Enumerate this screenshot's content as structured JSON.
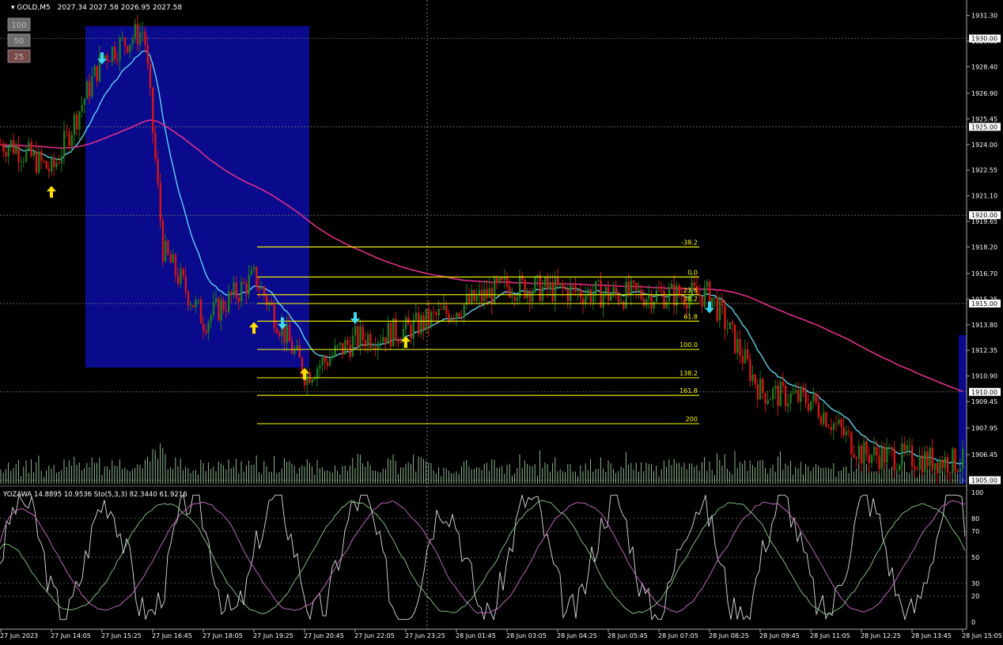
{
  "header": {
    "symbol": "GOLD,M5",
    "ohlc": "2027.34 2027.58 2026.95 2027.58"
  },
  "zoom_buttons": [
    "100",
    "50",
    "25"
  ],
  "indicator_header": "YOZAWA 14.8895 10.9536  Sto(5,3,3) 82.3440 61.9216",
  "colors": {
    "background": "#000000",
    "bull_bar": "#1e7a1e",
    "bear_bar": "#d41616",
    "ma_fast": "#5fd3f0",
    "ma_slow": "#e0308a",
    "fib": "#ffff00",
    "box": "#0a0a8c",
    "grid": "#7a7a7a",
    "axis_text": "#ffffff"
  },
  "price_axis": {
    "ticks": [
      "1931.30",
      "1929.85",
      "1928.40",
      "1926.90",
      "1925.45",
      "1924.00",
      "1922.55",
      "1921.10",
      "1919.65",
      "1918.20",
      "1916.70",
      "1915.25",
      "1913.80",
      "1912.35",
      "1910.90",
      "1909.45",
      "1907.95",
      "1906.45"
    ],
    "boxed_levels": [
      "1930.00",
      "1925.00",
      "1920.00",
      "1915.00",
      "1910.00",
      "1905.00"
    ]
  },
  "osc_axis": {
    "ticks": [
      "100",
      "80",
      "70",
      "50",
      "30",
      "20",
      "0"
    ]
  },
  "time_axis": [
    "27 Jun 2023",
    "27 Jun 14:05",
    "27 Jun 15:25",
    "27 Jun 16:45",
    "27 Jun 18:05",
    "27 Jun 19:25",
    "27 Jun 20:45",
    "27 Jun 22:05",
    "27 Jun 23:25",
    "28 Jun 01:45",
    "28 Jun 03:05",
    "28 Jun 04:25",
    "28 Jun 05:45",
    "28 Jun 07:05",
    "28 Jun 08:25",
    "28 Jun 09:45",
    "28 Jun 11:05",
    "28 Jun 12:25",
    "28 Jun 13:45",
    "28 Jun 15:05"
  ],
  "chart_data": {
    "type": "candlestick",
    "instrument": "GOLD",
    "timeframe": "M5",
    "ylim": [
      1904.8,
      1932.0
    ],
    "key_price_samples": [
      {
        "time": "27 Jun 13:00",
        "price": 1924.0
      },
      {
        "time": "27 Jun 14:05",
        "price": 1922.5
      },
      {
        "time": "27 Jun 15:25",
        "price": 1929.0
      },
      {
        "time": "27 Jun 16:30",
        "price": 1930.5
      },
      {
        "time": "27 Jun 17:00",
        "price": 1918.0
      },
      {
        "time": "27 Jun 18:05",
        "price": 1914.0
      },
      {
        "time": "27 Jun 19:25",
        "price": 1916.5
      },
      {
        "time": "27 Jun 20:45",
        "price": 1911.0
      },
      {
        "time": "27 Jun 22:05",
        "price": 1913.0
      },
      {
        "time": "27 Jun 23:25",
        "price": 1913.5
      },
      {
        "time": "28 Jun 03:05",
        "price": 1916.0
      },
      {
        "time": "28 Jun 05:45",
        "price": 1915.5
      },
      {
        "time": "28 Jun 08:25",
        "price": 1915.5
      },
      {
        "time": "28 Jun 09:45",
        "price": 1910.0
      },
      {
        "time": "28 Jun 11:05",
        "price": 1909.5
      },
      {
        "time": "28 Jun 12:25",
        "price": 1906.5
      },
      {
        "time": "28 Jun 15:05",
        "price": 1906.0
      }
    ],
    "fibonacci": {
      "levels": [
        {
          "label": "-38.2",
          "price": 1918.2
        },
        {
          "label": "0.0",
          "price": 1916.5
        },
        {
          "label": "23.6",
          "price": 1915.5
        },
        {
          "label": "38.2",
          "price": 1915.0
        },
        {
          "label": "61.8",
          "price": 1914.0
        },
        {
          "label": "100.0",
          "price": 1912.4
        },
        {
          "label": "138.2",
          "price": 1910.8
        },
        {
          "label": "161.8",
          "price": 1909.8
        },
        {
          "label": "200",
          "price": 1908.2
        }
      ]
    },
    "arrows": [
      {
        "dir": "up",
        "time": "27 Jun 14:05",
        "price": 1921.3
      },
      {
        "dir": "down",
        "time": "27 Jun 15:25",
        "price": 1928.9
      },
      {
        "dir": "up",
        "time": "27 Jun 19:25",
        "price": 1913.6
      },
      {
        "dir": "down",
        "time": "27 Jun 20:10",
        "price": 1913.9
      },
      {
        "dir": "up",
        "time": "27 Jun 20:45",
        "price": 1911.0
      },
      {
        "dir": "down",
        "time": "27 Jun 22:05",
        "price": 1914.2
      },
      {
        "dir": "up",
        "time": "27 Jun 23:25",
        "price": 1912.8
      },
      {
        "dir": "down",
        "time": "28 Jun 08:25",
        "price": 1914.8
      }
    ],
    "oscillator": {
      "name": "YOZAWA / Sto(5,3,3)",
      "values": [
        14.8895,
        10.9536,
        82.344,
        61.9216
      ],
      "ylim": [
        0,
        100
      ],
      "levels": [
        80,
        70,
        50,
        30,
        20
      ]
    }
  }
}
